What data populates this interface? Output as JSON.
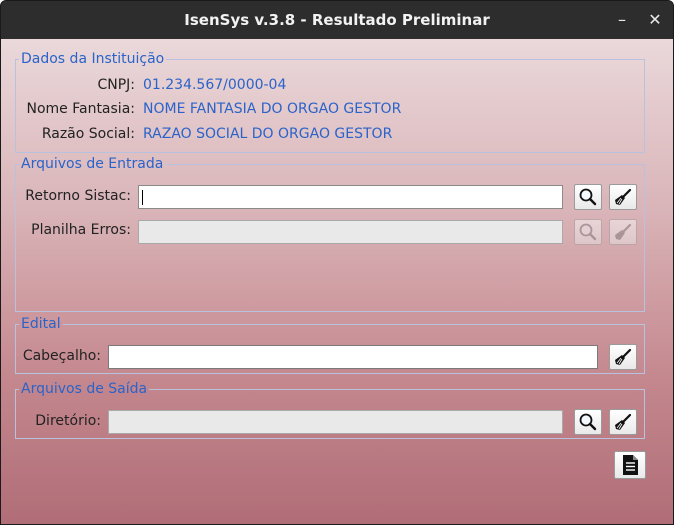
{
  "window": {
    "title": "IsenSys v.3.8 - Resultado Preliminar",
    "minimize": "–",
    "close": "✕"
  },
  "institution": {
    "legend": "Dados da Instituição",
    "cnpj_label": "CNPJ:",
    "cnpj_value": "01.234.567/0000-04",
    "fantasy_label": "Nome Fantasia:",
    "fantasy_value": "NOME FANTASIA DO ORGAO GESTOR",
    "social_label": "Razão Social:",
    "social_value": "RAZAO SOCIAL DO ORGAO GESTOR"
  },
  "input_files": {
    "legend": "Arquivos de Entrada",
    "retorno_label": "Retorno Sistac:",
    "retorno_value": "",
    "planilha_label": "Planilha Erros:",
    "planilha_value": ""
  },
  "edital": {
    "legend": "Edital",
    "header_label": "Cabeçalho:",
    "header_value": ""
  },
  "output_files": {
    "legend": "Arquivos de Saída",
    "dir_label": "Diretório:",
    "dir_value": ""
  },
  "colors": {
    "accent": "#2a63c9",
    "titlebar": "#2d2d2d"
  },
  "icons": {
    "search": "magnifier-icon",
    "clear": "broom-icon",
    "generate": "document-icon"
  }
}
